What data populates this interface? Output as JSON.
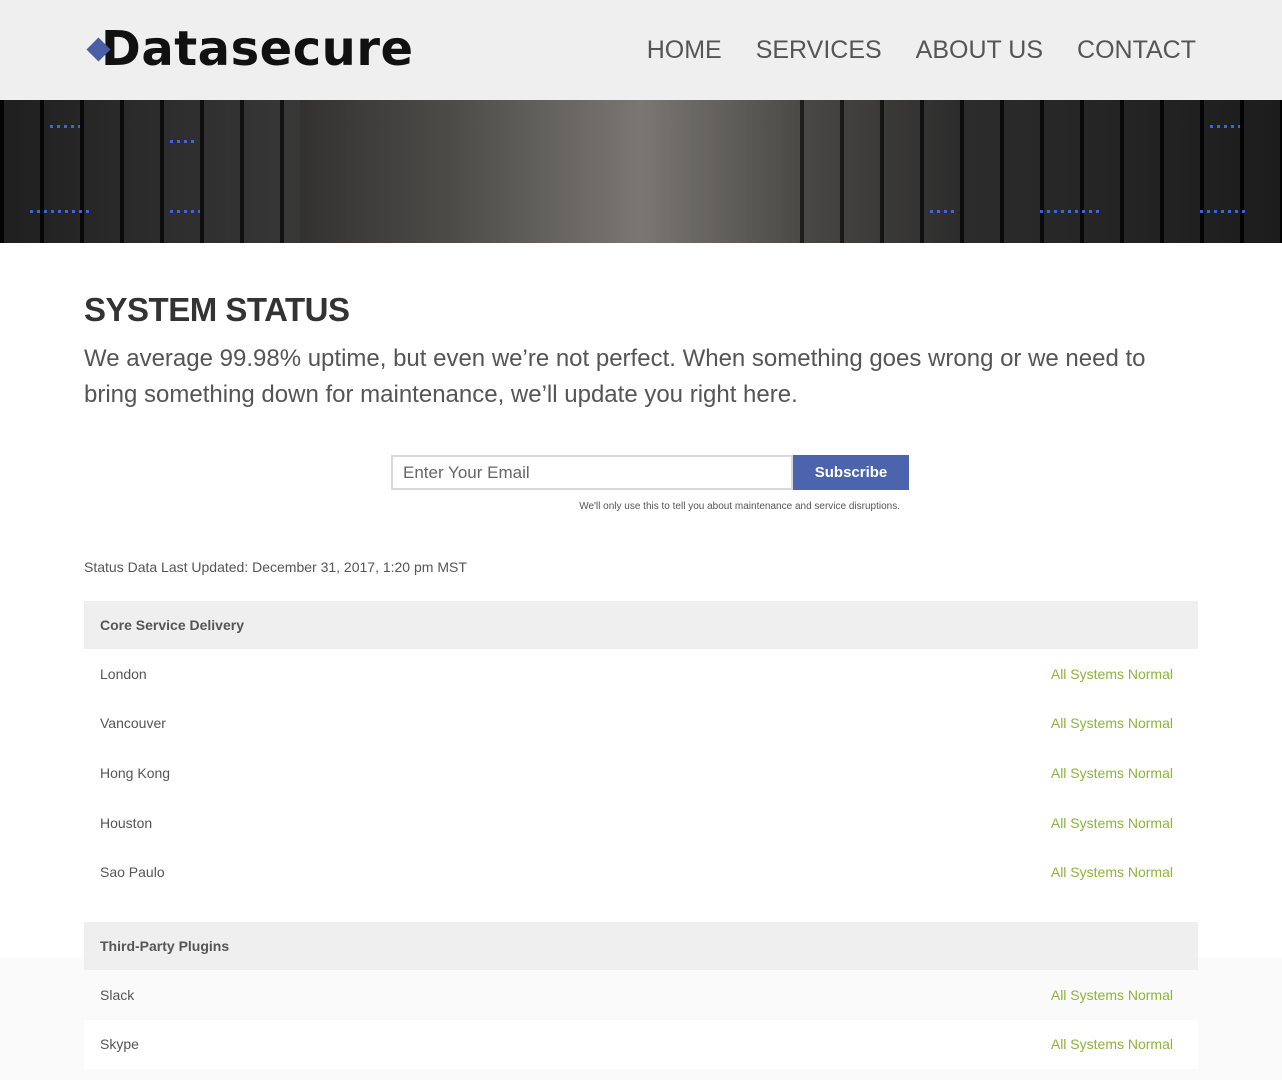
{
  "header": {
    "logo_text": "Datasecure",
    "nav": [
      "HOME",
      "SERVICES",
      "ABOUT US",
      "CONTACT"
    ]
  },
  "main": {
    "title": "SYSTEM STATUS",
    "intro": "We average 99.98% uptime, but even we’re not perfect. When something goes wrong or we need to bring something down for maintenance, we’ll update you right here.",
    "subscribe": {
      "placeholder": "Enter Your Email",
      "button_label": "Subscribe",
      "disclaimer": "We'll only use this to tell you about maintenance and service disruptions."
    },
    "updated": "Status Data Last Updated: December 31, 2017, 1:20 pm MST",
    "sections": [
      {
        "title": "Core Service Delivery",
        "rows": [
          {
            "name": "London",
            "status": "All Systems Normal"
          },
          {
            "name": "Vancouver",
            "status": "All Systems Normal"
          },
          {
            "name": "Hong Kong",
            "status": "All Systems Normal"
          },
          {
            "name": "Houston",
            "status": "All Systems Normal"
          },
          {
            "name": "Sao Paulo",
            "status": "All Systems Normal"
          }
        ]
      },
      {
        "title": "Third-Party Plugins",
        "rows": [
          {
            "name": "Slack",
            "status": "All Systems Normal"
          },
          {
            "name": "Skype",
            "status": "All Systems Normal"
          }
        ]
      }
    ]
  },
  "colors": {
    "brand": "#4b64ad",
    "status_ok": "#8db33a",
    "header_bg": "#efefef"
  },
  "icons": {
    "logo_mark": "blue-diamond-icon"
  }
}
